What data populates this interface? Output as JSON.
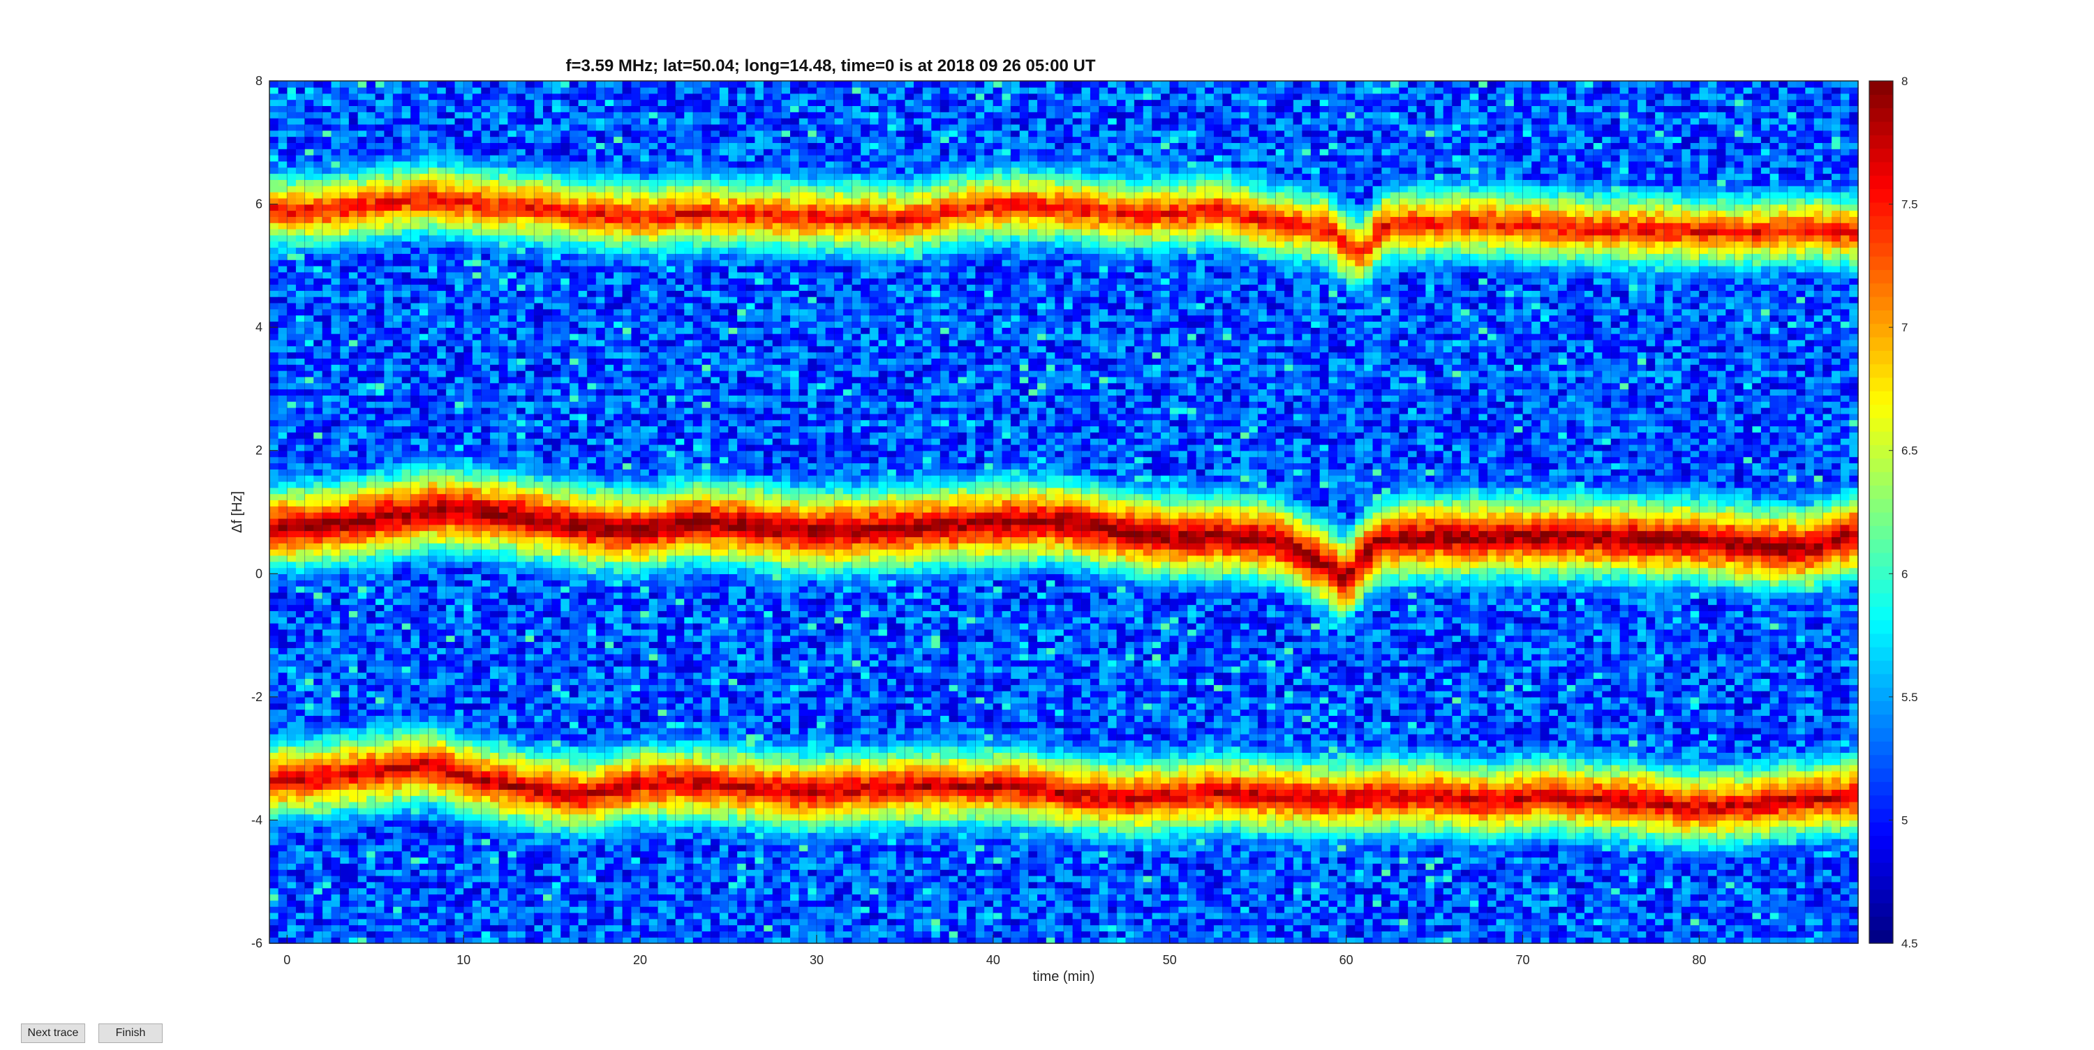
{
  "window": {
    "background": "#ffffff"
  },
  "controls": {
    "next_label": "Next trace",
    "finish_label": "Finish"
  },
  "chart_data": {
    "type": "heatmap",
    "title": "f=3.59 MHz;  lat=50.04; long=14.48, time=0 is at 2018 09 26 05:00 UT",
    "xlabel": "time (min)",
    "ylabel": "Δf [Hz]",
    "xlim": [
      -1,
      89
    ],
    "ylim": [
      -6,
      8
    ],
    "xticks": [
      0,
      10,
      20,
      30,
      40,
      50,
      60,
      70,
      80
    ],
    "yticks": [
      -6,
      -4,
      -2,
      0,
      2,
      4,
      6,
      8
    ],
    "colorbar": {
      "colormap": "jet",
      "clim": [
        4.5,
        8
      ],
      "ticks": [
        4.5,
        5,
        5.5,
        6,
        6.5,
        7,
        7.5,
        8
      ],
      "tick_labels": [
        "4.5",
        "5",
        "5.5",
        "6",
        "6.5",
        "7",
        "7.5",
        "8"
      ]
    },
    "background_level": 5.2,
    "traces": [
      {
        "name": "upper trace",
        "peak": 7.6,
        "x": [
          -1,
          2,
          5,
          8,
          11,
          14,
          17,
          20,
          23,
          26,
          29,
          32,
          35,
          38,
          41,
          44,
          47,
          50,
          53,
          56,
          59,
          60,
          61,
          62,
          65,
          68,
          71,
          74,
          77,
          80,
          83,
          86,
          89
        ],
        "y": [
          5.9,
          5.9,
          6.0,
          6.1,
          6.0,
          5.95,
          5.85,
          5.8,
          5.85,
          5.85,
          5.8,
          5.8,
          5.75,
          5.9,
          6.0,
          5.95,
          5.85,
          5.85,
          5.9,
          5.7,
          5.6,
          5.3,
          5.2,
          5.65,
          5.7,
          5.7,
          5.65,
          5.6,
          5.6,
          5.55,
          5.55,
          5.6,
          5.55
        ]
      },
      {
        "name": "middle trace",
        "peak": 8.0,
        "x": [
          -1,
          2,
          5,
          8,
          11,
          14,
          17,
          20,
          23,
          26,
          29,
          32,
          35,
          38,
          41,
          44,
          47,
          50,
          53,
          56,
          59,
          60,
          61,
          62,
          65,
          68,
          71,
          74,
          77,
          80,
          83,
          86,
          89
        ],
        "y": [
          0.75,
          0.8,
          0.9,
          1.05,
          1.0,
          0.9,
          0.75,
          0.7,
          0.85,
          0.8,
          0.7,
          0.7,
          0.75,
          0.8,
          0.85,
          0.85,
          0.7,
          0.6,
          0.6,
          0.55,
          0.1,
          -0.1,
          0.3,
          0.55,
          0.6,
          0.6,
          0.6,
          0.6,
          0.55,
          0.55,
          0.45,
          0.4,
          0.65
        ]
      },
      {
        "name": "lower trace",
        "peak": 7.8,
        "x": [
          -1,
          2,
          5,
          8,
          11,
          14,
          17,
          20,
          23,
          26,
          29,
          32,
          35,
          38,
          41,
          44,
          47,
          50,
          53,
          56,
          59,
          62,
          65,
          68,
          71,
          74,
          77,
          80,
          83,
          86,
          89
        ],
        "y": [
          -3.35,
          -3.3,
          -3.2,
          -3.1,
          -3.35,
          -3.5,
          -3.6,
          -3.4,
          -3.4,
          -3.45,
          -3.55,
          -3.5,
          -3.45,
          -3.45,
          -3.45,
          -3.55,
          -3.65,
          -3.6,
          -3.55,
          -3.6,
          -3.65,
          -3.6,
          -3.6,
          -3.7,
          -3.6,
          -3.65,
          -3.7,
          -3.8,
          -3.75,
          -3.65,
          -3.6
        ]
      }
    ]
  }
}
